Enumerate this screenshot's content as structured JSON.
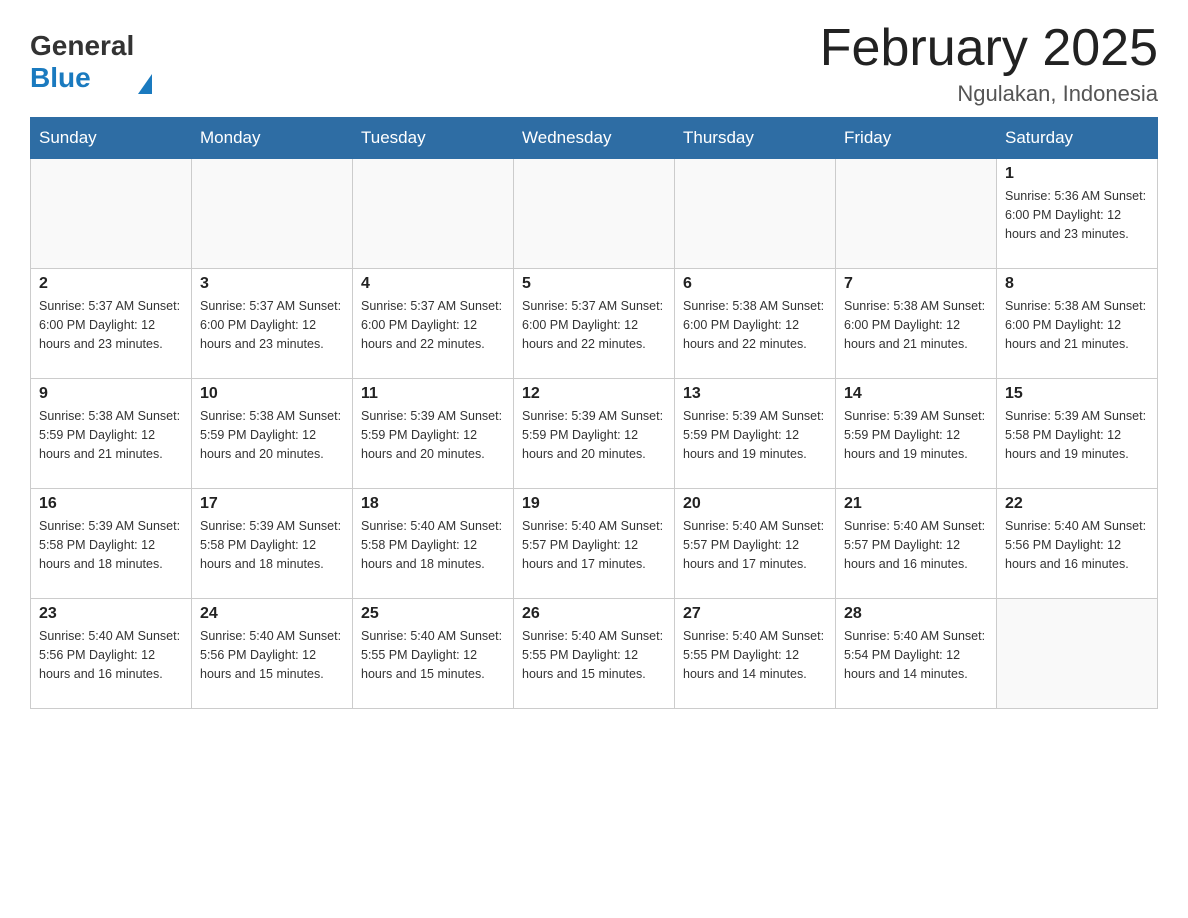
{
  "logo": {
    "general": "General",
    "blue": "Blue",
    "triangle": "▲"
  },
  "title": "February 2025",
  "subtitle": "Ngulakan, Indonesia",
  "days_header": [
    "Sunday",
    "Monday",
    "Tuesday",
    "Wednesday",
    "Thursday",
    "Friday",
    "Saturday"
  ],
  "weeks": [
    [
      {
        "day": "",
        "info": ""
      },
      {
        "day": "",
        "info": ""
      },
      {
        "day": "",
        "info": ""
      },
      {
        "day": "",
        "info": ""
      },
      {
        "day": "",
        "info": ""
      },
      {
        "day": "",
        "info": ""
      },
      {
        "day": "1",
        "info": "Sunrise: 5:36 AM\nSunset: 6:00 PM\nDaylight: 12 hours and 23 minutes."
      }
    ],
    [
      {
        "day": "2",
        "info": "Sunrise: 5:37 AM\nSunset: 6:00 PM\nDaylight: 12 hours and 23 minutes."
      },
      {
        "day": "3",
        "info": "Sunrise: 5:37 AM\nSunset: 6:00 PM\nDaylight: 12 hours and 23 minutes."
      },
      {
        "day": "4",
        "info": "Sunrise: 5:37 AM\nSunset: 6:00 PM\nDaylight: 12 hours and 22 minutes."
      },
      {
        "day": "5",
        "info": "Sunrise: 5:37 AM\nSunset: 6:00 PM\nDaylight: 12 hours and 22 minutes."
      },
      {
        "day": "6",
        "info": "Sunrise: 5:38 AM\nSunset: 6:00 PM\nDaylight: 12 hours and 22 minutes."
      },
      {
        "day": "7",
        "info": "Sunrise: 5:38 AM\nSunset: 6:00 PM\nDaylight: 12 hours and 21 minutes."
      },
      {
        "day": "8",
        "info": "Sunrise: 5:38 AM\nSunset: 6:00 PM\nDaylight: 12 hours and 21 minutes."
      }
    ],
    [
      {
        "day": "9",
        "info": "Sunrise: 5:38 AM\nSunset: 5:59 PM\nDaylight: 12 hours and 21 minutes."
      },
      {
        "day": "10",
        "info": "Sunrise: 5:38 AM\nSunset: 5:59 PM\nDaylight: 12 hours and 20 minutes."
      },
      {
        "day": "11",
        "info": "Sunrise: 5:39 AM\nSunset: 5:59 PM\nDaylight: 12 hours and 20 minutes."
      },
      {
        "day": "12",
        "info": "Sunrise: 5:39 AM\nSunset: 5:59 PM\nDaylight: 12 hours and 20 minutes."
      },
      {
        "day": "13",
        "info": "Sunrise: 5:39 AM\nSunset: 5:59 PM\nDaylight: 12 hours and 19 minutes."
      },
      {
        "day": "14",
        "info": "Sunrise: 5:39 AM\nSunset: 5:59 PM\nDaylight: 12 hours and 19 minutes."
      },
      {
        "day": "15",
        "info": "Sunrise: 5:39 AM\nSunset: 5:58 PM\nDaylight: 12 hours and 19 minutes."
      }
    ],
    [
      {
        "day": "16",
        "info": "Sunrise: 5:39 AM\nSunset: 5:58 PM\nDaylight: 12 hours and 18 minutes."
      },
      {
        "day": "17",
        "info": "Sunrise: 5:39 AM\nSunset: 5:58 PM\nDaylight: 12 hours and 18 minutes."
      },
      {
        "day": "18",
        "info": "Sunrise: 5:40 AM\nSunset: 5:58 PM\nDaylight: 12 hours and 18 minutes."
      },
      {
        "day": "19",
        "info": "Sunrise: 5:40 AM\nSunset: 5:57 PM\nDaylight: 12 hours and 17 minutes."
      },
      {
        "day": "20",
        "info": "Sunrise: 5:40 AM\nSunset: 5:57 PM\nDaylight: 12 hours and 17 minutes."
      },
      {
        "day": "21",
        "info": "Sunrise: 5:40 AM\nSunset: 5:57 PM\nDaylight: 12 hours and 16 minutes."
      },
      {
        "day": "22",
        "info": "Sunrise: 5:40 AM\nSunset: 5:56 PM\nDaylight: 12 hours and 16 minutes."
      }
    ],
    [
      {
        "day": "23",
        "info": "Sunrise: 5:40 AM\nSunset: 5:56 PM\nDaylight: 12 hours and 16 minutes."
      },
      {
        "day": "24",
        "info": "Sunrise: 5:40 AM\nSunset: 5:56 PM\nDaylight: 12 hours and 15 minutes."
      },
      {
        "day": "25",
        "info": "Sunrise: 5:40 AM\nSunset: 5:55 PM\nDaylight: 12 hours and 15 minutes."
      },
      {
        "day": "26",
        "info": "Sunrise: 5:40 AM\nSunset: 5:55 PM\nDaylight: 12 hours and 15 minutes."
      },
      {
        "day": "27",
        "info": "Sunrise: 5:40 AM\nSunset: 5:55 PM\nDaylight: 12 hours and 14 minutes."
      },
      {
        "day": "28",
        "info": "Sunrise: 5:40 AM\nSunset: 5:54 PM\nDaylight: 12 hours and 14 minutes."
      },
      {
        "day": "",
        "info": ""
      }
    ]
  ]
}
